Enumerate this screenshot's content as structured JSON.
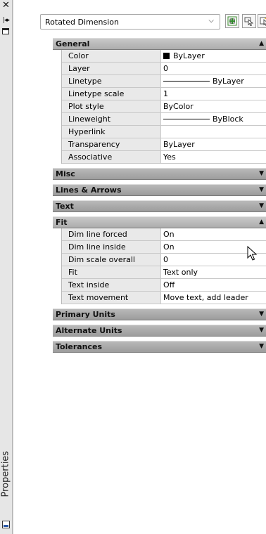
{
  "palette": {
    "title": "Properties"
  },
  "toolbar": {
    "selection_type": "Rotated Dimension"
  },
  "categories": [
    {
      "name": "General",
      "expanded": true,
      "rows": [
        {
          "label": "Color",
          "value": "ByLayer",
          "kind": "color"
        },
        {
          "label": "Layer",
          "value": "0"
        },
        {
          "label": "Linetype",
          "value": "ByLayer",
          "kind": "line"
        },
        {
          "label": "Linetype scale",
          "value": "1"
        },
        {
          "label": "Plot style",
          "value": "ByColor"
        },
        {
          "label": "Lineweight",
          "value": "ByBlock",
          "kind": "line"
        },
        {
          "label": "Hyperlink",
          "value": ""
        },
        {
          "label": "Transparency",
          "value": "ByLayer"
        },
        {
          "label": "Associative",
          "value": "Yes"
        }
      ]
    },
    {
      "name": "Misc",
      "expanded": false,
      "rows": []
    },
    {
      "name": "Lines & Arrows",
      "expanded": false,
      "rows": []
    },
    {
      "name": "Text",
      "expanded": false,
      "rows": []
    },
    {
      "name": "Fit",
      "expanded": true,
      "rows": [
        {
          "label": "Dim line forced",
          "value": "On"
        },
        {
          "label": "Dim line inside",
          "value": "On"
        },
        {
          "label": "Dim scale overall",
          "value": "0"
        },
        {
          "label": "Fit",
          "value": "Text only"
        },
        {
          "label": "Text inside",
          "value": "Off"
        },
        {
          "label": "Text movement",
          "value": "Move text, add leader"
        }
      ]
    },
    {
      "name": "Primary Units",
      "expanded": false,
      "rows": []
    },
    {
      "name": "Alternate Units",
      "expanded": false,
      "rows": []
    },
    {
      "name": "Tolerances",
      "expanded": false,
      "rows": []
    }
  ]
}
